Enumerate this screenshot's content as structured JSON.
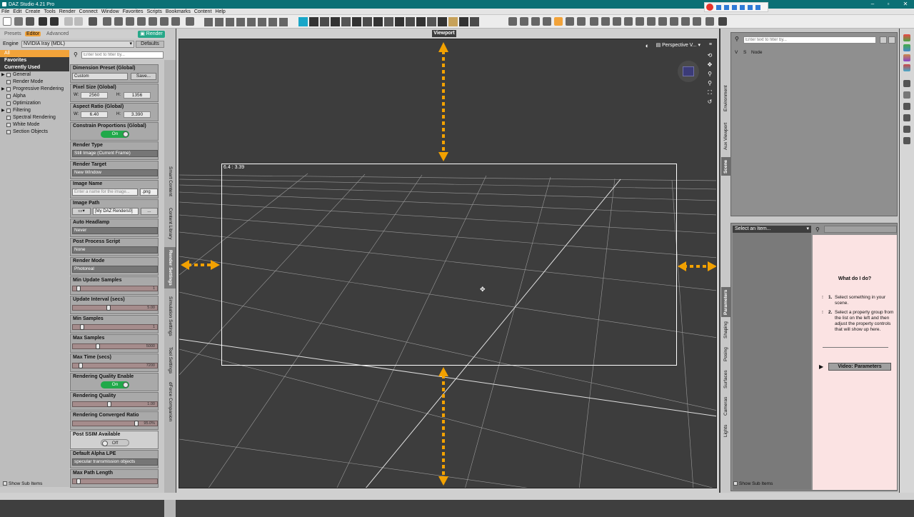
{
  "window": {
    "title": "DAZ Studio 4.21 Pro"
  },
  "menu": [
    "File",
    "Edit",
    "Create",
    "Tools",
    "Render",
    "Connect",
    "Window",
    "Favorites",
    "Scripts",
    "Bookmarks",
    "Content",
    "Help"
  ],
  "left_panel": {
    "tabs": {
      "presets": "Presets",
      "editor": "Editor",
      "advanced": "Advanced"
    },
    "render_button": "Render",
    "engine_label": "Engine",
    "engine_value": "NVIDIA Iray (MDL)",
    "defaults_button": "Defaults",
    "filter_placeholder": "Enter text to filter by...",
    "groups": [
      "All",
      "Favorites",
      "Currently Used",
      "General",
      "Render Mode",
      "Progressive Rendering",
      "Alpha",
      "Optimization",
      "Filtering",
      "Spectral Rendering",
      "White Mode",
      "Section Objects"
    ],
    "show_sub_items": "Show Sub Items",
    "side_tabs": [
      "Smart Content",
      "Content Library",
      "Render Settings",
      "Simulation Settings",
      "Tool Settings",
      "dForce Companion"
    ]
  },
  "props": {
    "dimension_preset": {
      "title": "Dimension Preset (Global)",
      "value": "Custom",
      "button": "Save..."
    },
    "pixel_size": {
      "title": "Pixel Size (Global)",
      "w_label": "W:",
      "w": "2560",
      "h_label": "H:",
      "h": "1356"
    },
    "aspect_ratio": {
      "title": "Aspect Ratio (Global)",
      "w_label": "W:",
      "w": "6.40",
      "h_label": "H:",
      "h": "3.390"
    },
    "constrain": {
      "title": "Constrain Proportions (Global)",
      "value": "On"
    },
    "render_type": {
      "title": "Render Type",
      "value": "Still Image (Current Frame)"
    },
    "render_target": {
      "title": "Render Target",
      "value": "New Window"
    },
    "image_name": {
      "title": "Image Name",
      "placeholder": "Enter a name for the image...",
      "ext": ".png"
    },
    "image_path": {
      "title": "Image Path",
      "value": "[My DAZ Renders0]",
      "button": "..."
    },
    "auto_headlamp": {
      "title": "Auto Headlamp",
      "value": "Never"
    },
    "post_process": {
      "title": "Post Process Script",
      "value": "None"
    },
    "render_mode": {
      "title": "Render Mode",
      "value": "Photoreal"
    },
    "min_update": {
      "title": "Min Update Samples",
      "value": "1"
    },
    "update_interval": {
      "title": "Update Interval (secs)",
      "value": "5.00"
    },
    "min_samples": {
      "title": "Min Samples",
      "value": "1"
    },
    "max_samples": {
      "title": "Max Samples",
      "value": "5000"
    },
    "max_time": {
      "title": "Max Time (secs)",
      "value": "7200"
    },
    "quality_enable": {
      "title": "Rendering Quality Enable",
      "value": "On"
    },
    "quality": {
      "title": "Rendering Quality",
      "value": "1.00"
    },
    "converged": {
      "title": "Rendering Converged Ratio",
      "value": "95.0%"
    },
    "post_ssim": {
      "title": "Post SSIM Available",
      "value": "Off"
    },
    "alpha_lpe": {
      "title": "Default Alpha LPE",
      "value": "specular transmission objects"
    },
    "max_path": {
      "title": "Max Path Length",
      "value": ""
    }
  },
  "viewport": {
    "tab_label": "Viewport",
    "camera": "Perspective V...",
    "ratio_label": "6.4 : 3.39"
  },
  "right_panel": {
    "scene_filter_placeholder": "Enter text to filter by...",
    "scene_cols": {
      "v": "V",
      "s": "S",
      "node": "Node"
    },
    "top_tabs": [
      "Environment",
      "Aux Viewport",
      "Scene"
    ],
    "bottom_tabs": [
      "Parameters",
      "Shaping",
      "Posing",
      "Surfaces",
      "Cameras",
      "Lights"
    ],
    "select_item": "Select an Item...",
    "help_title": "What do I do?",
    "help_1_num": "1.",
    "help_1": "Select something in your scene.",
    "help_2_num": "2.",
    "help_2": "Select a property group from the list on the left and then adjust the property controls that will show up here.",
    "video_button": "Video: Parameters",
    "show_sub_items": "Show Sub Items"
  }
}
